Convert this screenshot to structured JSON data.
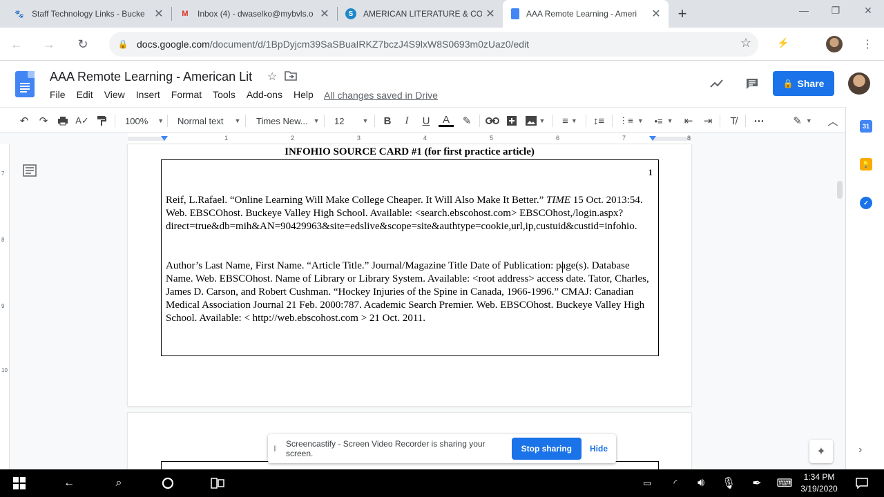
{
  "browser": {
    "tabs": [
      {
        "title": "Staff Technology Links - Bucke",
        "icon": "staff-tech-favicon",
        "active": false
      },
      {
        "title": "Inbox (4) - dwaselko@mybvls.o",
        "icon": "gmail-favicon",
        "active": false
      },
      {
        "title": "AMERICAN LITERATURE & COMP",
        "icon": "schoology-favicon",
        "active": false
      },
      {
        "title": "AAA Remote Learning - Ameri",
        "icon": "google-docs-favicon",
        "active": true
      }
    ],
    "new_tab": "+",
    "url_host": "docs.google.com",
    "url_path": "/document/d/1BpDyjcm39SaSBuaIRKZ7bczJ4S9lxW8S0693m0zUaz0/edit"
  },
  "docs": {
    "title": "AAA Remote Learning - American Lit",
    "menu": [
      "File",
      "Edit",
      "View",
      "Insert",
      "Format",
      "Tools",
      "Add-ons",
      "Help"
    ],
    "save_status": "All changes saved in Drive",
    "share_label": "Share"
  },
  "toolbar": {
    "zoom": "100%",
    "style": "Normal text",
    "font": "Times New...",
    "size": "12"
  },
  "ruler": {
    "ticks": [
      "1",
      "2",
      "3",
      "4",
      "5",
      "6",
      "7",
      "8"
    ],
    "vticks": [
      "7",
      "8",
      "9",
      "10"
    ]
  },
  "document": {
    "heading": "INFOHIO SOURCE CARD #1 (for first practice article)",
    "page_marker": "1",
    "citation1": {
      "before": "Reif, L.Rafael. “Online Learning Will Make College Cheaper. It Will Also Make It Better.” ",
      "italic": "TIME",
      "after": " 15 Oct. 2013:54.  Web.  EBSCOhost. Buckeye Valley High School. Available: <search.ebscohost.com> EBSCOhost,/login.aspx?direct=true&db=mih&AN=90429963&site=edslive&scope=site&authtype=cookie,url,ip,custuid&custid=infohio."
    },
    "citation2": "Author’s Last Name, First Name. “Article Title.” Journal/Magazine Title Date of Publication: page(s). Database  Name. Web.  EBSCOhost. Name of Library or Library System. Available: <root address> access date. Tator, Charles, James D. Carson, and Robert Cushman. “Hockey Injuries of the Spine in Canada, 1966-1996.”  CMAJ: Canadian Medical Association Journal 21 Feb. 2000:787. Academic Search Premier. Web.  EBSCOhost. Buckeye Valley High School. Available: < http://web.ebscohost.com > 21 Oct. 2011."
  },
  "sidepanel": {
    "calendar_day": "31"
  },
  "share_banner": {
    "message": "Screencastify - Screen Video Recorder is sharing your screen.",
    "stop": "Stop sharing",
    "hide": "Hide"
  },
  "taskbar": {
    "time": "1:34 PM",
    "date": "3/19/2020"
  },
  "colors": {
    "accent": "#1a73e8",
    "docs_blue": "#4285f4",
    "tab_strip": "#dee1e6"
  }
}
